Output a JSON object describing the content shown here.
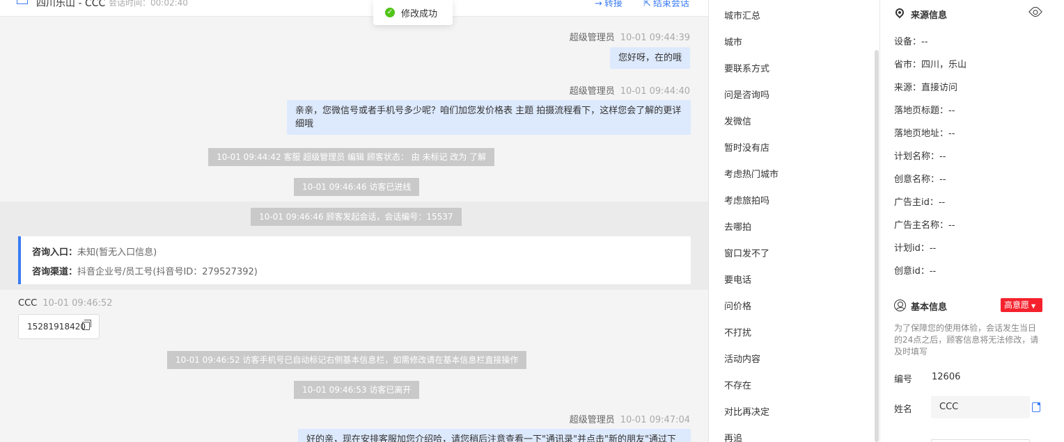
{
  "header": {
    "visitor_name": "四川乐山 - CCC",
    "session_time": "会话时间：00:02:40",
    "transfer_label": "转接",
    "end_label": "结束会话",
    "transfer_icon": "→",
    "end_icon": "⇱"
  },
  "toast": {
    "icon": "✓",
    "message": "修改成功"
  },
  "messages": {
    "m1_sender": "超级管理员",
    "m1_time": "10-01 09:44:39",
    "m1_text": "您好呀，在的哦",
    "m2_sender": "超级管理员",
    "m2_time": "10-01 09:44:40",
    "m2_text": "亲亲，您微信号或者手机号多少呢？咱们加您发价格表 主题 拍摄流程看下，这样您会了解的更详细哦",
    "s1": "10-01 09:44:42 客服 超级管理员 编辑 顾客状态： 由 未标记 改为 了解",
    "s2": "10-01 09:46:46 访客已进线",
    "s3": "10-01 09:46:46 顾客发起会话，会话编号：15537",
    "consult_entry_label": "咨询入口：",
    "consult_entry_value": "未知(暂无入口信息)",
    "consult_channel_label": "咨询渠道：",
    "consult_channel_value": "抖音企业号/员工号(抖音号ID：279527392)",
    "c1_sender": "CCC",
    "c1_time": "10-01 09:46:52",
    "c1_phone": "15281918420",
    "s4": "10-01 09:46:52 访客手机号已自动标记右侧基本信息栏，如需修改请在基本信息栏直接操作",
    "s5": "10-01 09:46:53 访客已离开",
    "m3_sender": "超级管理员",
    "m3_time": "10-01 09:47:04",
    "m3_text": "好的亲，现在安排客服加您介绍哈，请您稍后注意查看一下\"通讯录\"并点击\"新的朋友\"通过下哦"
  },
  "tags": [
    "城市汇总",
    "城市",
    "要联系方式",
    "问是咨询吗",
    "发微信",
    "暂时没有店",
    "考虑热门城市",
    "考虑旅拍吗",
    "去哪拍",
    "窗口发不了",
    "要电话",
    "问价格",
    "不打扰",
    "活动内容",
    "不存在",
    "对比再决定",
    "再追"
  ],
  "source": {
    "title": "来源信息",
    "device": "设备：--",
    "province": "省市：四川，乐山",
    "origin": "来源：直接访问",
    "landing_title": "落地页标题：--",
    "landing_url": "落地页地址：--",
    "plan_name": "计划名称：--",
    "creative_name": "创意名称：--",
    "advertiser_id": "广告主id：--",
    "advertiser_name": "广告主名称：--",
    "plan_id": "计划id：--",
    "creative_id": "创意id：--"
  },
  "basic": {
    "title": "基本信息",
    "intent_badge": "高意愿",
    "intent_color": "#f5222d",
    "notice": "为了保障您的使用体验，会话发生当日的24点之后，顾客信息将无法修改，请及时填写",
    "id_label": "编号",
    "id_value": "12606",
    "name_label": "姓名",
    "name_value": "CCC"
  },
  "colors": {
    "accent": "#3a7bf5",
    "success": "#52c41a",
    "bubble": "#dde9fc"
  }
}
